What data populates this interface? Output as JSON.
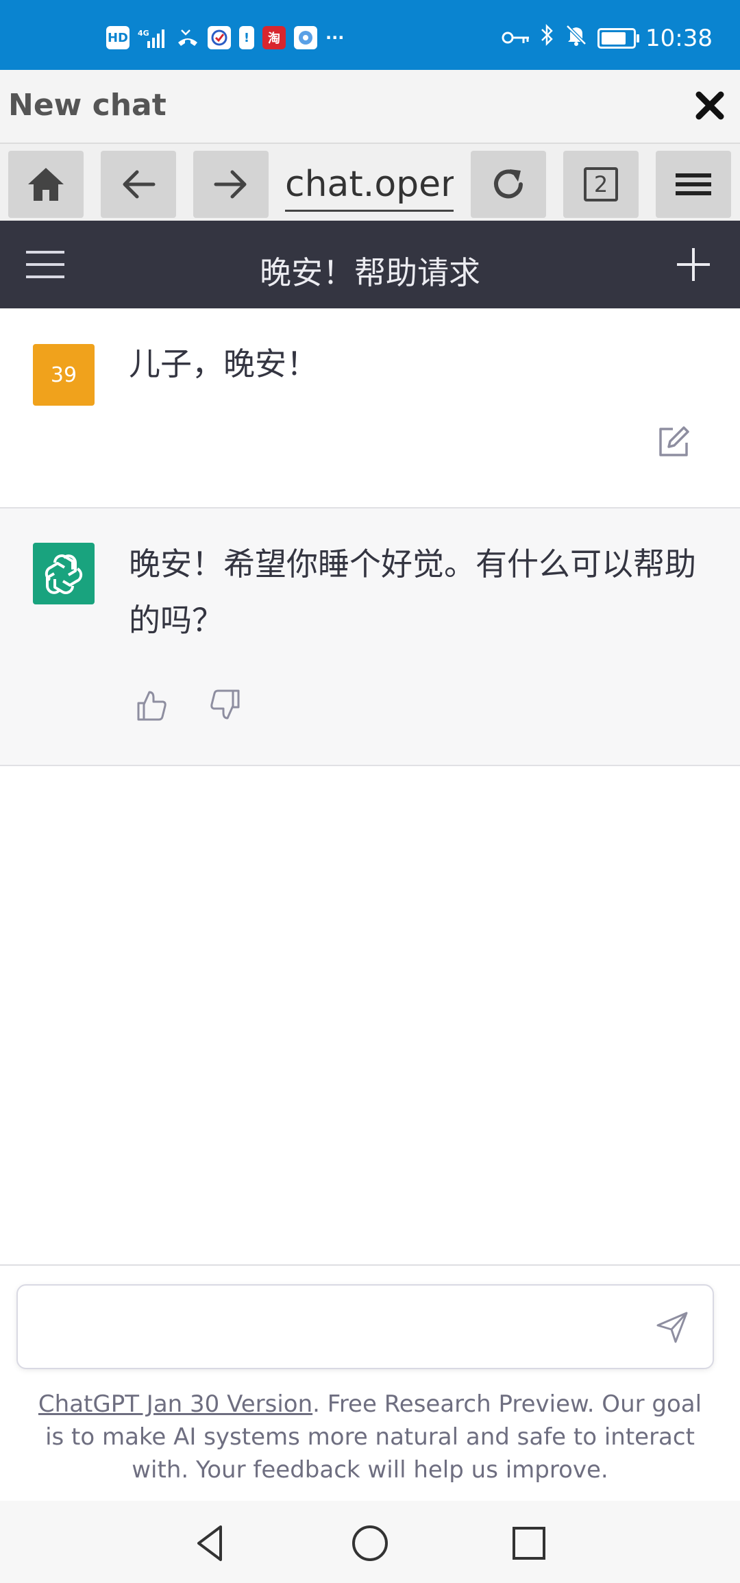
{
  "status_bar": {
    "left_icons": [
      "hd-icon",
      "4g-signal-icon",
      "missed-call-icon",
      "app-icon",
      "alert-icon",
      "taobao-icon",
      "browser-icon"
    ],
    "hd_label": "HD",
    "more": "···",
    "time": "10:38",
    "right_icons": [
      "key-icon",
      "bluetooth-icon",
      "mute-bell-icon",
      "battery-icon"
    ],
    "battery_level": 0.7
  },
  "browser": {
    "tab_title": "New chat",
    "url": "chat.open",
    "tab_count": "2"
  },
  "app_header": {
    "title": "晚安！帮助请求"
  },
  "messages": [
    {
      "role": "user",
      "avatar_text": "39",
      "text": "儿子，晚安！"
    },
    {
      "role": "assistant",
      "text": "晚安！希望你睡个好觉。有什么可以帮助的吗？"
    }
  ],
  "input": {
    "value": "",
    "placeholder": ""
  },
  "footer": {
    "link_text": "ChatGPT Jan 30 Version",
    "note_text": ". Free Research Preview. Our goal is to make AI systems more natural and safe to interact with. Your feedback will help us improve."
  },
  "colors": {
    "status_bar": "#0a84d0",
    "app_header": "#343541",
    "user_avatar": "#f0a21c",
    "bot_avatar": "#19a37e",
    "assistant_bg": "#f7f7f8"
  }
}
